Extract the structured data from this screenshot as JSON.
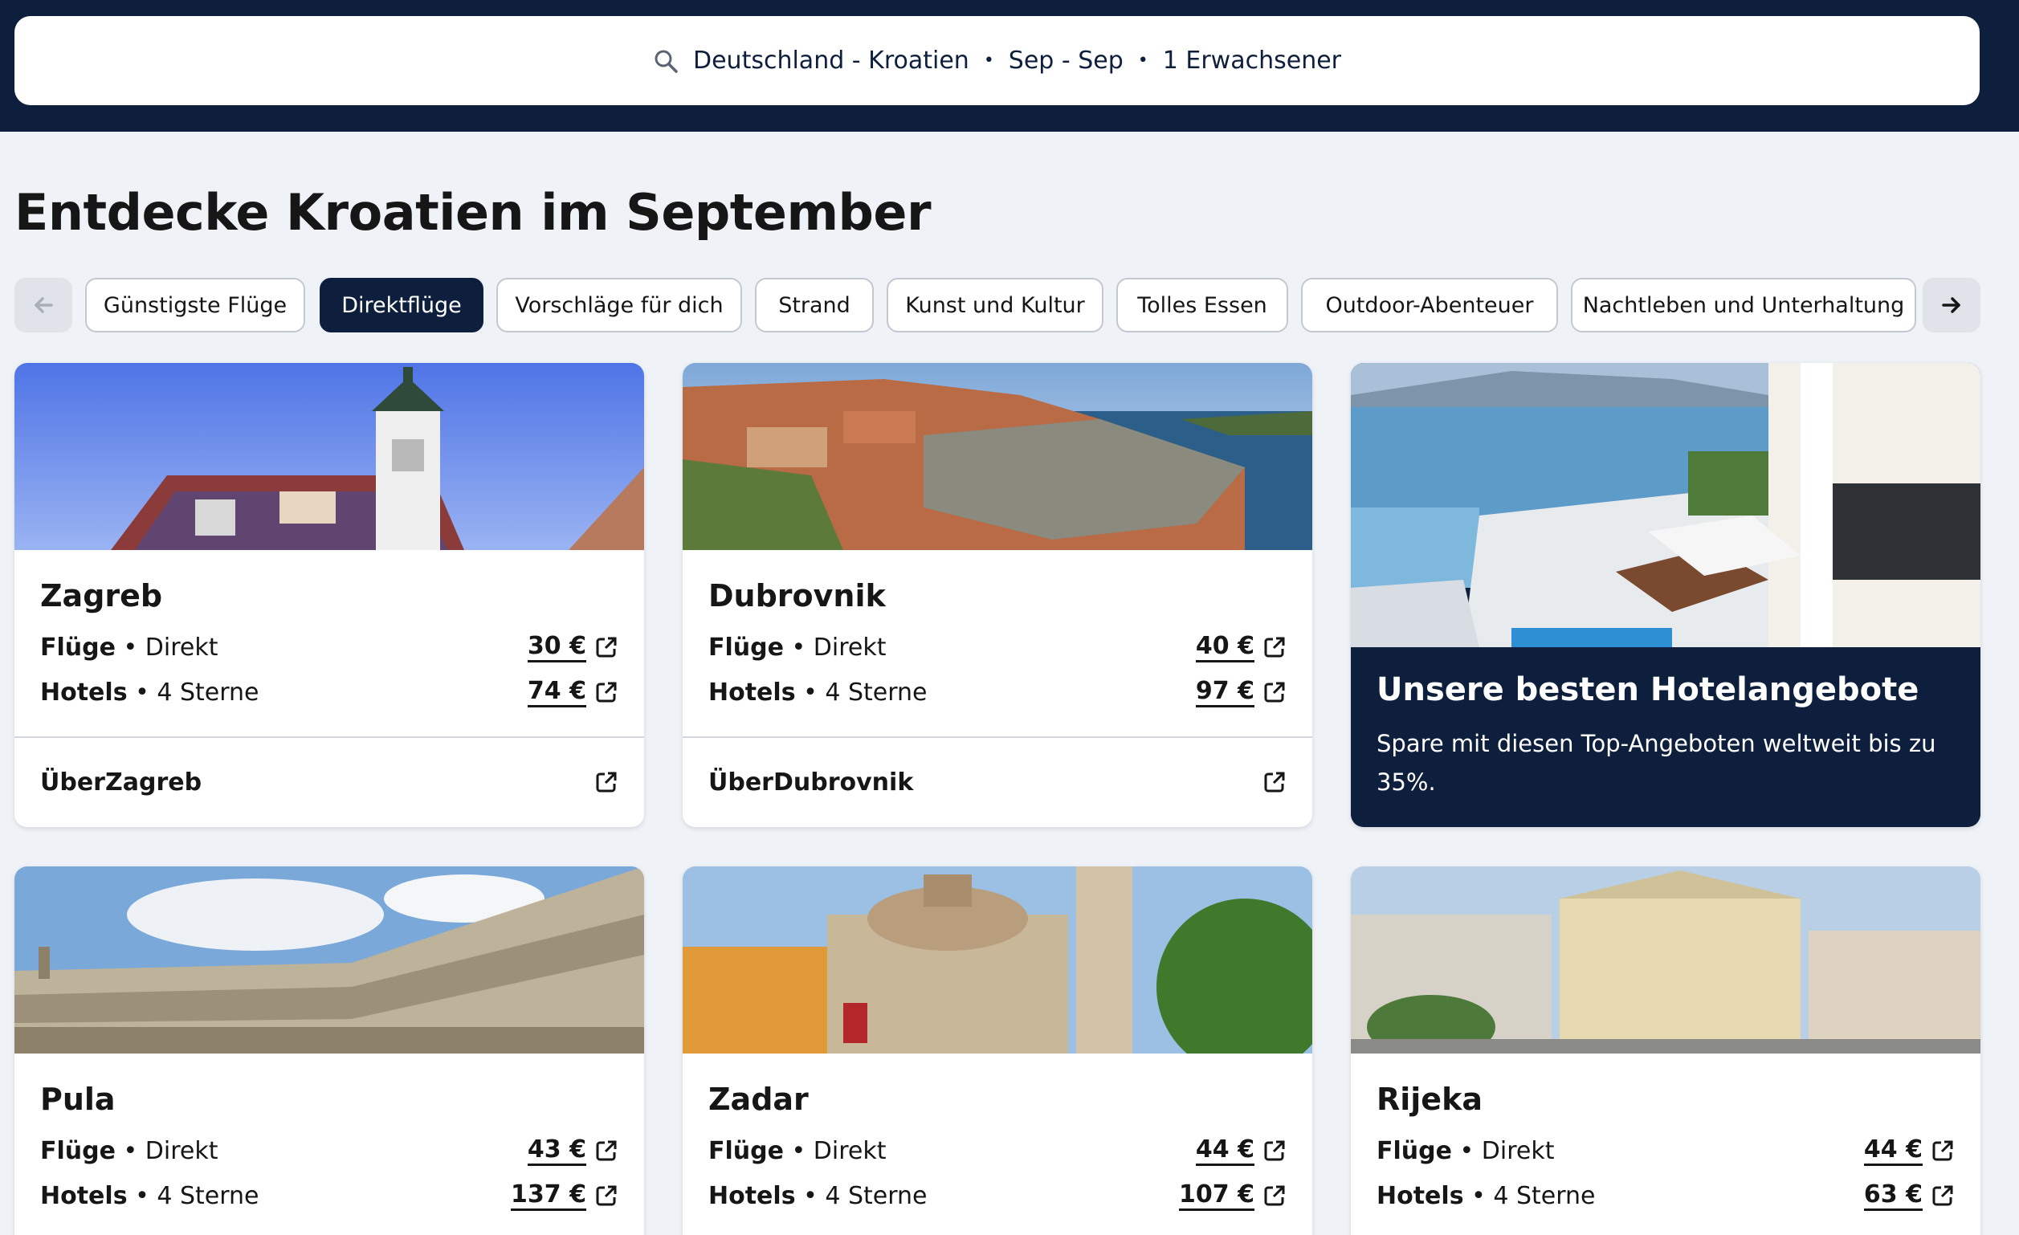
{
  "search": {
    "route": "Deutschland - Kroatien",
    "dates": "Sep - Sep",
    "travellers": "1 Erwachsener",
    "separator": "•"
  },
  "page": {
    "title": "Entdecke Kroatien im September"
  },
  "chips": [
    {
      "label": "Günstigste Flüge",
      "active": false
    },
    {
      "label": "Direktflüge",
      "active": true
    },
    {
      "label": "Vorschläge für dich",
      "active": false
    },
    {
      "label": "Strand",
      "active": false
    },
    {
      "label": "Kunst und Kultur",
      "active": false
    },
    {
      "label": "Tolles Essen",
      "active": false
    },
    {
      "label": "Outdoor-Abenteuer",
      "active": false
    },
    {
      "label": "Nachtleben und Unterhaltung",
      "active": false
    }
  ],
  "labels": {
    "flights": "Flüge",
    "flights_type": "Direkt",
    "hotels": "Hotels",
    "hotels_type": "4 Sterne",
    "dot": "•"
  },
  "cards": [
    {
      "city": "Zagreb",
      "flight_price": "30 €",
      "hotel_price": "74 €",
      "about": "ÜberZagreb"
    },
    {
      "city": "Dubrovnik",
      "flight_price": "40 €",
      "hotel_price": "97 €",
      "about": "ÜberDubrovnik"
    },
    {
      "city": "Pula",
      "flight_price": "43 €",
      "hotel_price": "137 €"
    },
    {
      "city": "Zadar",
      "flight_price": "44 €",
      "hotel_price": "107 €"
    },
    {
      "city": "Rijeka",
      "flight_price": "44 €",
      "hotel_price": "63 €"
    }
  ],
  "promo": {
    "title": "Unsere besten Hotelangebote",
    "text": "Spare mit diesen Top-Angeboten weltweit bis zu 35%."
  },
  "colors": {
    "header_bg": "#0d1f3c",
    "page_bg": "#eff3f8",
    "chip_active_bg": "#0d1f3c"
  },
  "icons": {
    "search": "search-icon",
    "prev": "arrow-left-icon",
    "next": "arrow-right-icon",
    "external": "external-link-icon"
  }
}
